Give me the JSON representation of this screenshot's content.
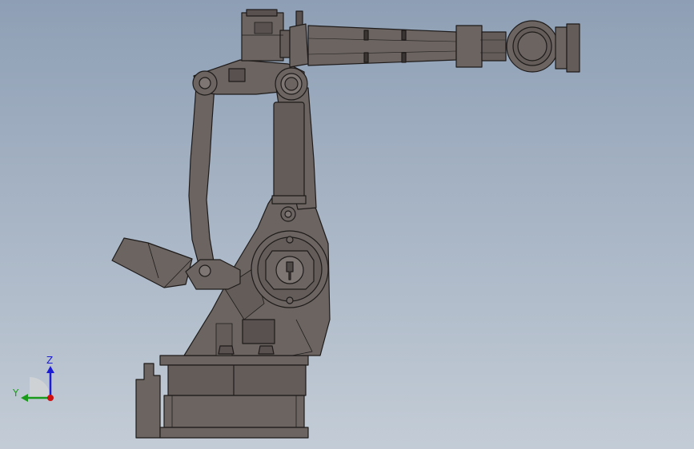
{
  "triad": {
    "z_label": "Z",
    "y_label": "Y",
    "z_color": "#1c1cd6",
    "y_color": "#1a9a1a",
    "x_color": "#d01010"
  },
  "colors": {
    "background_top": "#8e9fb5",
    "background_bottom": "#c3ccd6",
    "robot_body": "#6b6461",
    "robot_shade": "#58514f",
    "robot_light": "#7d7673",
    "outline": "#1e1b1a"
  }
}
